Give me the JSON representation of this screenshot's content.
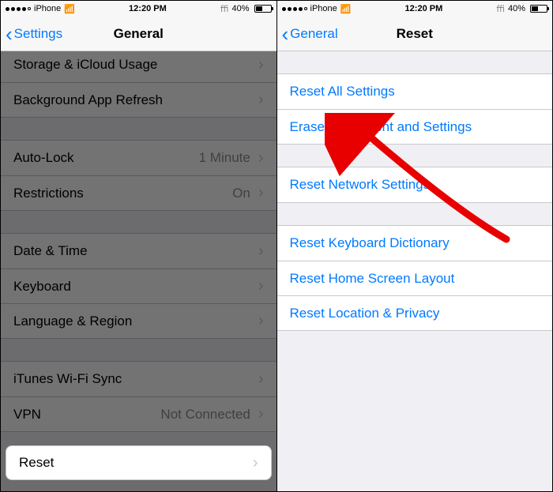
{
  "statusbar": {
    "carrier": "iPhone",
    "time": "12:20 PM",
    "battery_pct": "40%"
  },
  "left": {
    "back_label": "Settings",
    "title": "General",
    "cut_row_label": "Storage & iCloud Usage",
    "rows": {
      "background_refresh": "Background App Refresh",
      "auto_lock": "Auto-Lock",
      "auto_lock_detail": "1 Minute",
      "restrictions": "Restrictions",
      "restrictions_detail": "On",
      "date_time": "Date & Time",
      "keyboard": "Keyboard",
      "language_region": "Language & Region",
      "itunes_wifi": "iTunes Wi-Fi Sync",
      "vpn": "VPN",
      "vpn_detail": "Not Connected",
      "reset": "Reset"
    }
  },
  "right": {
    "back_label": "General",
    "title": "Reset",
    "rows": {
      "reset_all": "Reset All Settings",
      "erase_all": "Erase All Content and Settings",
      "reset_network": "Reset Network Settings",
      "reset_keyboard": "Reset Keyboard Dictionary",
      "reset_home": "Reset Home Screen Layout",
      "reset_location": "Reset Location & Privacy"
    }
  }
}
